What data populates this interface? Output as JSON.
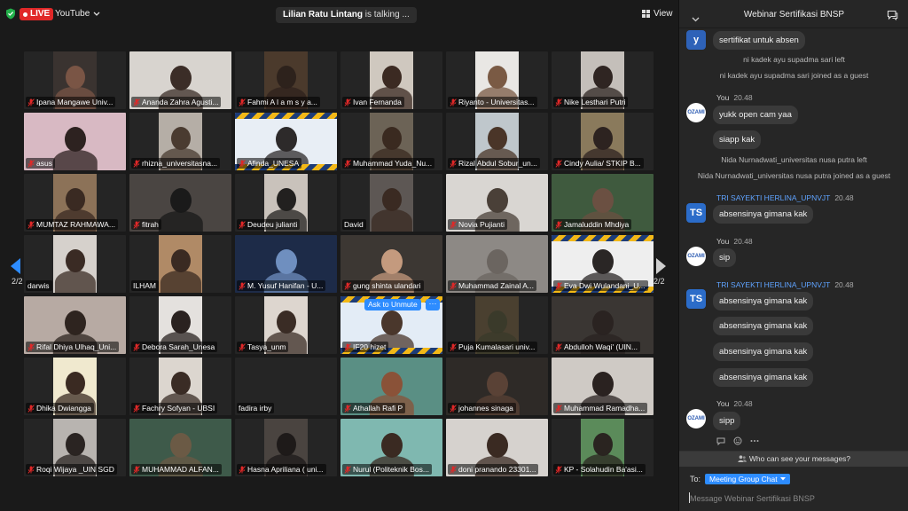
{
  "topbar": {
    "live_label": "LIVE",
    "platform_label": "YouTube",
    "talking_name": "Lilian Ratu Lintang",
    "talking_suffix": " is talking ...",
    "view_label": "View"
  },
  "pager": {
    "left_label": "2/2",
    "right_label": "2/2"
  },
  "hover": {
    "unmute_label": "Ask to Unmute",
    "more_label": "···"
  },
  "participants": [
    {
      "name": "Ipana Mangawe Univ...",
      "muted": true,
      "bg": "#3a3330",
      "face": "#7a5545",
      "cam": "narrow"
    },
    {
      "name": "Ananda Zahra Agusti...",
      "muted": true,
      "bg": "#d8d4cf",
      "face": "#3b2d27",
      "cam": "wide"
    },
    {
      "name": "Fahmi  A l a m s y a...",
      "muted": true,
      "bg": "#4b3a2c",
      "face": "#2d221c",
      "cam": "narrow"
    },
    {
      "name": "Ivan Fernanda",
      "muted": true,
      "bg": "#cfc8bf",
      "face": "#3b2a22",
      "cam": "narrow"
    },
    {
      "name": "Riyanto - Universitas...",
      "muted": true,
      "bg": "#e9e7e4",
      "face": "#7a5a44",
      "cam": "narrow"
    },
    {
      "name": "Nike Lesthari Putri",
      "muted": true,
      "bg": "#c4bfba",
      "face": "#2f2522",
      "cam": "narrow"
    },
    {
      "name": "asus",
      "muted": true,
      "bg": "#d8b9c3",
      "face": "#2d2220",
      "cam": "wide"
    },
    {
      "name": "rhizna_universitasna...",
      "muted": true,
      "bg": "#b5aea6",
      "face": "#4a3b30",
      "cam": "narrow"
    },
    {
      "name": "Afinda_UNESA",
      "muted": true,
      "bg": "#e8eef5",
      "face": "#2d2a2a",
      "cam": "wide",
      "stripe": true
    },
    {
      "name": "Muhammad Yuda_Nu...",
      "muted": true,
      "bg": "#6c6356",
      "face": "#3a2a20",
      "cam": "narrow"
    },
    {
      "name": "Rizal Abdul Sobur_un...",
      "muted": true,
      "bg": "#bfc7cc",
      "face": "#4a3528",
      "cam": "narrow"
    },
    {
      "name": "Cindy Aulia/ STKIP B...",
      "muted": true,
      "bg": "#8a7a5c",
      "face": "#2d2320",
      "cam": "narrow"
    },
    {
      "name": "MUMTAZ RAHMAWA...",
      "muted": true,
      "bg": "#8c7258",
      "face": "#3a2a22",
      "cam": "narrow"
    },
    {
      "name": "fitrah",
      "muted": true,
      "bg": "#4a4542",
      "face": "#1a1a1a",
      "cam": "wide"
    },
    {
      "name": "Deudeu julianti",
      "muted": true,
      "bg": "#c9c2bb",
      "face": "#22201f",
      "cam": "narrow"
    },
    {
      "name": "David",
      "muted": false,
      "bg": "#5d5754",
      "face": "#3a2a22",
      "cam": "narrow"
    },
    {
      "name": "Novia Pujianti",
      "muted": true,
      "bg": "#d9d6d2",
      "face": "#4a4038",
      "cam": "wide"
    },
    {
      "name": "Jamaluddin Mhdiya",
      "muted": true,
      "bg": "#3f5a3e",
      "face": "#6b5042",
      "cam": "wide"
    },
    {
      "name": "darwis",
      "muted": false,
      "bg": "#d6d1cc",
      "face": "#3a2b24",
      "cam": "narrow"
    },
    {
      "name": "ILHAM",
      "muted": false,
      "bg": "#b08a66",
      "face": "#3a2a22",
      "cam": "narrow"
    },
    {
      "name": "M. Yusuf Hanifan - U...",
      "muted": true,
      "bg": "#1d2b48",
      "face": "#6f8fbf",
      "cam": "wide"
    },
    {
      "name": "gung shinta ulandari",
      "muted": true,
      "bg": "#3c3733",
      "face": "#c49a7e",
      "cam": "wide"
    },
    {
      "name": "Muhammad Zainal A...",
      "muted": true,
      "bg": "#8d8985",
      "face": "#6b6560",
      "cam": "wide"
    },
    {
      "name": "Eva Dwi Wulandani_U...",
      "muted": true,
      "bg": "#eeeeee",
      "face": "#2a2625",
      "cam": "wide",
      "stripe": true
    },
    {
      "name": "Rifal Dhiya Ulhaq_Uni...",
      "muted": true,
      "bg": "#b7aaa3",
      "face": "#2e241f",
      "cam": "wide"
    },
    {
      "name": "Debora Sarah_Unesa",
      "muted": true,
      "bg": "#e4e1de",
      "face": "#2a2220",
      "cam": "narrow"
    },
    {
      "name": "Tasya_unm",
      "muted": true,
      "bg": "#ddd6cf",
      "face": "#3a2c25",
      "cam": "narrow"
    },
    {
      "name": "IF20 hizet",
      "muted": true,
      "bg": "#e3ecf6",
      "face": "#4a372c",
      "cam": "wide",
      "stripe": true,
      "hover": true
    },
    {
      "name": "Puja Kumalasari univ...",
      "muted": true,
      "bg": "#4a4030",
      "face": "#3a3a2a",
      "cam": "narrow"
    },
    {
      "name": "Abdulloh Waqi' (UIN...",
      "muted": true,
      "bg": "#3a3633",
      "face": "#2a2321",
      "cam": "wide"
    },
    {
      "name": "Dhika Dwiangga",
      "muted": true,
      "bg": "#f0e9cf",
      "face": "#3a2a22",
      "cam": "narrow"
    },
    {
      "name": "Fachry Sofyan - UBSI",
      "muted": true,
      "bg": "#dcd6cf",
      "face": "#3a2c25",
      "cam": "narrow"
    },
    {
      "name": "fadira irby",
      "muted": false,
      "bg": "",
      "face": "",
      "cam": "none"
    },
    {
      "name": "Athallah Rafi P",
      "muted": true,
      "bg": "#5a8f84",
      "face": "#8a5238",
      "cam": "wide"
    },
    {
      "name": "johannes sinaga",
      "muted": true,
      "bg": "#2e2a27",
      "face": "#5a4236",
      "cam": "wide"
    },
    {
      "name": "Muhammad Ramadha...",
      "muted": true,
      "bg": "#cfcac5",
      "face": "#2a2220",
      "cam": "wide"
    },
    {
      "name": "Roqi Wijaya _UIN SGD",
      "muted": true,
      "bg": "#b8b4b0",
      "face": "#2a2422",
      "cam": "narrow"
    },
    {
      "name": "MUHAMMAD ALFAN...",
      "muted": true,
      "bg": "#3e5a4a",
      "face": "#6b5a45",
      "cam": "wide"
    },
    {
      "name": "Hasna Apriliana ( uni...",
      "muted": true,
      "bg": "#4a4440",
      "face": "#1e1a19",
      "cam": "narrow"
    },
    {
      "name": "Nurul (Politeknik Bos...",
      "muted": true,
      "bg": "#7fb8b0",
      "face": "#3a2a22",
      "cam": "wide"
    },
    {
      "name": "doni pranando 23301...",
      "muted": true,
      "bg": "#d6d2ce",
      "face": "#3a2a22",
      "cam": "wide"
    },
    {
      "name": "KP - Solahudin Ba'asi...",
      "muted": true,
      "bg": "#5b8b5a",
      "face": "#2a2420",
      "cam": "narrow"
    }
  ],
  "chat": {
    "title": "Webinar Sertifikasi BNSP",
    "messages": [
      {
        "kind": "bubble",
        "text": "sertifikat untuk absen"
      },
      {
        "kind": "system",
        "text": "ni kadek ayu supadma sari left"
      },
      {
        "kind": "system",
        "text": "ni kadek ayu supadma sari joined as a guest"
      },
      {
        "kind": "sender",
        "name": "You",
        "time": "20.48"
      },
      {
        "kind": "bubble",
        "text": "yukk open cam yaa"
      },
      {
        "kind": "bubble",
        "text": "siapp kak"
      },
      {
        "kind": "system",
        "text": "Nida Nurnadwati_universitas nusa putra left"
      },
      {
        "kind": "system",
        "text": "Nida Nurnadwati_universitas nusa putra joined as a guest"
      },
      {
        "kind": "sender",
        "name": "TRI SAYEKTI HERLINA_UPNVJT",
        "time": "20.48"
      },
      {
        "kind": "bubble",
        "text": "absensinya gimana kak"
      },
      {
        "kind": "sender",
        "name": "You",
        "time": "20.48"
      },
      {
        "kind": "bubble",
        "text": "sip"
      },
      {
        "kind": "sender",
        "name": "TRI SAYEKTI HERLINA_UPNVJT",
        "time": "20.48"
      },
      {
        "kind": "bubble",
        "text": "absensinya gimana kak"
      },
      {
        "kind": "bubble",
        "text": "absensinya gimana kak"
      },
      {
        "kind": "bubble",
        "text": "absensinya gimana kak"
      },
      {
        "kind": "bubble",
        "text": "absensinya gimana kak"
      },
      {
        "kind": "sender",
        "name": "You",
        "time": "20.48"
      },
      {
        "kind": "bubble",
        "text": "sipp"
      }
    ],
    "avatars": {
      "y_letter": "y",
      "ts_letters": "TS",
      "ozami_label": "OZAMI"
    },
    "who_can_see": "Who can see your messages?",
    "to_label": "To:",
    "to_value": "Meeting Group Chat",
    "input_placeholder": "Message Webinar Sertifikasi BNSP"
  },
  "colors": {
    "accent": "#2d8cff",
    "live": "#e02828",
    "mic_muted": "#e02828"
  }
}
